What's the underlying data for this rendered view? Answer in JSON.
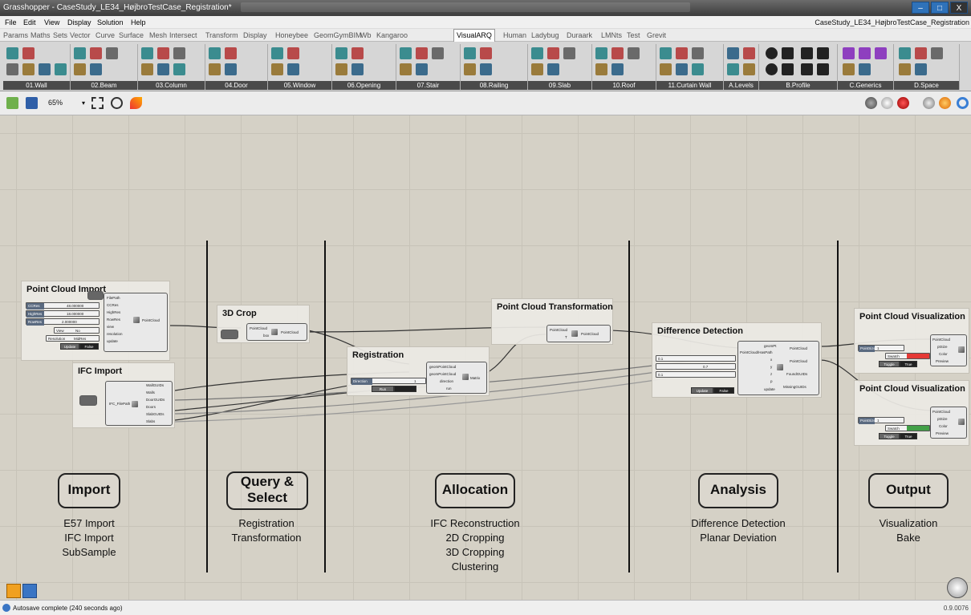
{
  "window": {
    "title": "Grasshopper - CaseStudy_LE34_HøjbroTestCase_Registration*",
    "minimize": "–",
    "maximize": "□",
    "close": "X"
  },
  "menu": {
    "items": [
      "File",
      "Edit",
      "View",
      "Display",
      "Solution",
      "Help"
    ],
    "document_title": "CaseStudy_LE34_HøjbroTestCase_Registration"
  },
  "tabs": [
    "Params",
    "Maths",
    "Sets",
    "Vector",
    "Curve",
    "Surface",
    "Mesh",
    "Intersect",
    "Transform",
    "Display",
    "Honeybee",
    "GeomGymBIM",
    "Wb",
    "Kangaroo",
    "VisualARQ",
    "Human",
    "Ladybug",
    "Duraark",
    "LMNts",
    "Test",
    "Grevit"
  ],
  "active_tab": "VisualARQ",
  "ribbon_groups": [
    "01.Wall",
    "02.Beam",
    "03.Column",
    "04.Door",
    "05.Window",
    "06.Opening",
    "07.Stair",
    "08.Railing",
    "09.Slab",
    "10.Roof",
    "11.Curtain Wall",
    "A.Levels",
    "B.Profile",
    "C.Generics",
    "D.Space"
  ],
  "toolbar": {
    "zoom": "65%"
  },
  "nodes": {
    "pci": {
      "title": "Point Cloud Import",
      "inputs": [
        "FilePath",
        "CCRes",
        "HighRes",
        "RowRes",
        "view",
        "resolution",
        "update"
      ],
      "output": "PointCloud",
      "sliders": [
        {
          "label": "CCRes",
          "value": "48.000000"
        },
        {
          "label": "HighRes",
          "value": "18.000000"
        },
        {
          "label": "RowRes",
          "value": "2.000000"
        }
      ],
      "view_label": "View",
      "view_value": "No",
      "res_label": "Resolution",
      "res_value": "MidRes",
      "update_label": "Update",
      "update_value": "False"
    },
    "ifc": {
      "title": "IFC Import",
      "input": "IFC_FilePath",
      "outputs": [
        "WallGUIDs",
        "Walls",
        "DoorGUIDs",
        "Doors",
        "SlabGUIDs",
        "Slabs"
      ]
    },
    "crop": {
      "title": "3D Crop",
      "inputs": [
        "PointCloud",
        "box"
      ],
      "output": "PointCloud"
    },
    "reg": {
      "title": "Registration",
      "inputs": [
        "geomPointCloud",
        "geomPointCloud",
        "direction",
        "run"
      ],
      "output": "Matrix",
      "direction_label": "Direction",
      "direction_value": "1",
      "run_label": "Run"
    },
    "pct": {
      "title": "Point Cloud Transformation",
      "inputs": [
        "PointCloud",
        "T"
      ],
      "output": "PointCloud"
    },
    "dd": {
      "title": "Difference Detection",
      "inputs": [
        "geomPt",
        "PointCloud/HasPath",
        "x",
        "y",
        "z",
        "p",
        "update"
      ],
      "outputs": [
        "PointCloud",
        "PointCloud",
        "FoundGUIDs",
        "MissingGUIDs"
      ],
      "sliders": [
        "0.1",
        "0.7",
        "0.1"
      ],
      "update_label": "Update",
      "update_value": "False"
    },
    "pcv1": {
      "title": "Point Cloud Visualization",
      "inputs": [
        "PointCloud",
        "ptSize",
        "Color",
        "Preview"
      ],
      "pointsize_label": "PointSize",
      "pointsize_value": "1",
      "swatch_label": "Swatch",
      "toggle_label": "Toggle",
      "toggle_value": "True",
      "swatch_color": "#e53935"
    },
    "pcv2": {
      "title": "Point Cloud Visualization",
      "inputs": [
        "PointCloud",
        "ptSize",
        "Color",
        "Preview"
      ],
      "pointsize_label": "PointSize",
      "pointsize_value": "1",
      "swatch_label": "Swatch",
      "toggle_label": "Toggle",
      "toggle_value": "True",
      "swatch_color": "#43a047"
    }
  },
  "phases": [
    {
      "title": "Import",
      "items": [
        "E57 Import",
        "IFC Import",
        "SubSample"
      ]
    },
    {
      "title_line1": "Query &",
      "title_line2": "Select",
      "items": [
        "Registration",
        "Transformation"
      ]
    },
    {
      "title": "Allocation",
      "items": [
        "IFC Reconstruction",
        "2D Cropping",
        "3D Cropping",
        "Clustering"
      ]
    },
    {
      "title": "Analysis",
      "items": [
        "Difference Detection",
        "Planar Deviation"
      ]
    },
    {
      "title": "Output",
      "items": [
        "Visualization",
        "Bake"
      ]
    }
  ],
  "status": {
    "text": "Autosave complete (240 seconds ago)",
    "version": "0.9.0076"
  },
  "colors": {
    "canvas": "#d5d1c6",
    "ribbon_label": "#4a4a4a",
    "swatch_red": "#e53935",
    "swatch_green": "#43a047"
  }
}
